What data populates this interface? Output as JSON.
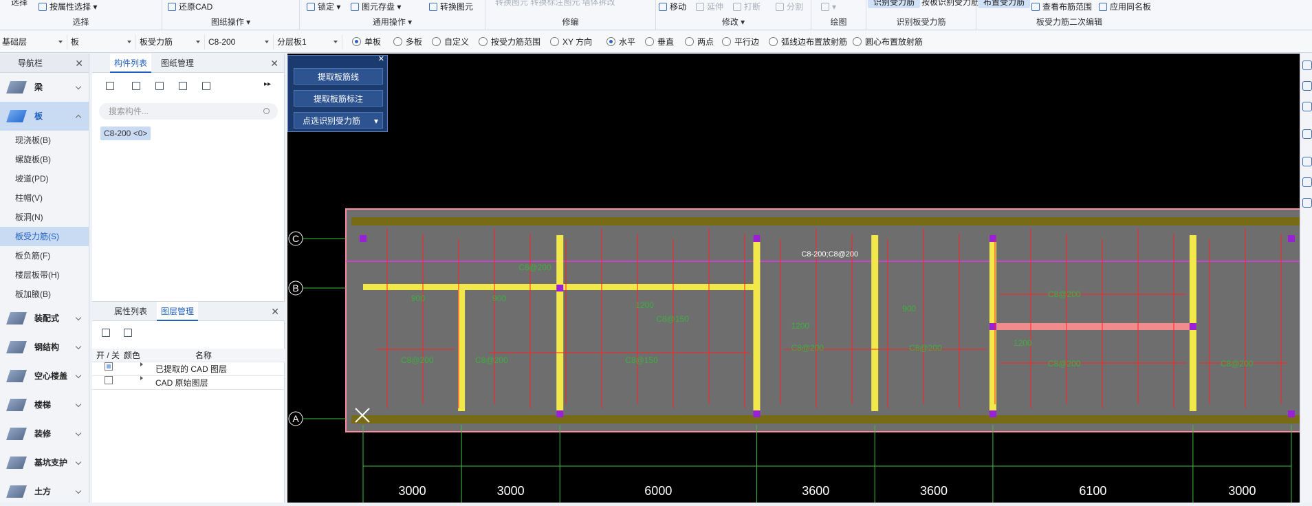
{
  "ribbon": {
    "select": {
      "filter_label": "按属性选择",
      "label": "选择",
      "partial": "选择"
    },
    "drawing": {
      "restore_label": "还原CAD",
      "label": "图纸操作"
    },
    "common": {
      "lock_label": "锁定",
      "store_label": "图元存盘",
      "convert_label": "转换图元",
      "label": "通用操作"
    },
    "modify_group": {
      "label": "修编",
      "faded": "转换图元 转换标注图元  墙体拆改"
    },
    "edit": {
      "move_label": "移动",
      "extend_label": "延伸",
      "break_label": "打断",
      "split_label": "分割",
      "label": "修改"
    },
    "draw": {
      "label": "绘图"
    },
    "identify": {
      "btn1": "识别受力筋",
      "btn2": "按板识别受力筋",
      "label": "识别板受力筋"
    },
    "second_edit": {
      "layout_label": "布置受力筋",
      "range_label": "查看布筋范围",
      "apply_label": "应用同名板",
      "label": "板受力筋二次编辑"
    }
  },
  "options": {
    "floor": "基础层",
    "type": "板",
    "subtype": "板受力筋",
    "spec": "C8-200",
    "layer": "分层板1",
    "radios": [
      {
        "label": "单板",
        "on": true
      },
      {
        "label": "多板",
        "on": false
      },
      {
        "label": "自定义",
        "on": false
      },
      {
        "label": "按受力筋范围",
        "on": false
      },
      {
        "label": "XY 方向",
        "on": false
      },
      {
        "label": "水平",
        "on": true
      },
      {
        "label": "垂直",
        "on": false
      },
      {
        "label": "两点",
        "on": false
      },
      {
        "label": "平行边",
        "on": false
      },
      {
        "label": "弧线边布置放射筋",
        "on": false
      },
      {
        "label": "圆心布置放射筋",
        "on": false
      }
    ]
  },
  "nav": {
    "title": "导航栏",
    "categories_top": [
      {
        "label": "梁",
        "icon": "beam-icon",
        "active": false
      },
      {
        "label": "板",
        "icon": "slab-icon",
        "active": true
      }
    ],
    "subitems": [
      {
        "label": "现浇板(B)",
        "active": false
      },
      {
        "label": "螺旋板(B)",
        "active": false
      },
      {
        "label": "坡道(PD)",
        "active": false
      },
      {
        "label": "柱帽(V)",
        "active": false
      },
      {
        "label": "板洞(N)",
        "active": false
      },
      {
        "label": "板受力筋(S)",
        "active": true
      },
      {
        "label": "板负筋(F)",
        "active": false
      },
      {
        "label": "楼层板带(H)",
        "active": false
      },
      {
        "label": "板加腋(B)",
        "active": false
      }
    ],
    "categories_bottom": [
      {
        "label": "装配式",
        "icon": "prefab-icon"
      },
      {
        "label": "钢结构",
        "icon": "steel-icon"
      },
      {
        "label": "空心楼盖",
        "icon": "hollow-floor-icon"
      },
      {
        "label": "楼梯",
        "icon": "stairs-icon"
      },
      {
        "label": "装修",
        "icon": "decoration-icon"
      },
      {
        "label": "基坑支护",
        "icon": "pit-support-icon"
      },
      {
        "label": "土方",
        "icon": "earthwork-icon"
      }
    ]
  },
  "components": {
    "tab_list": "构件列表",
    "tab_drawing": "图纸管理",
    "search_placeholder": "搜索构件...",
    "items": [
      "C8-200 <0>"
    ]
  },
  "layers": {
    "tab_props": "属性列表",
    "tab_layers": "图层管理",
    "col_toggle": "开 / 关",
    "col_color": "颜色",
    "col_name": "名称",
    "rows": [
      {
        "name": "已提取的 CAD 图层",
        "on": true
      },
      {
        "name": "CAD 原始图层",
        "on": false
      }
    ]
  },
  "float_panel": {
    "btn1": "提取板筋线",
    "btn2": "提取板筋标注",
    "btn3": "点选识别受力筋"
  },
  "cad": {
    "axes_rows": [
      "C",
      "B",
      "A"
    ],
    "spans": [
      {
        "label": "3000",
        "value": 3000
      },
      {
        "label": "3000",
        "value": 3000
      },
      {
        "label": "6000",
        "value": 6000
      },
      {
        "label": "3600",
        "value": 3600
      },
      {
        "label": "3600",
        "value": 3600
      },
      {
        "label": "6100",
        "value": 6100
      },
      {
        "label": "3000",
        "value": 3000
      }
    ],
    "header_note": "C8-200;C8@200",
    "rebar_labels": [
      "C8@200",
      "C8@200",
      "C8@200",
      "C8@150",
      "C8@200",
      "C8@200",
      "C8@200",
      "C8@200",
      "C8@200",
      "C8@150"
    ],
    "dims": [
      "900",
      "900",
      "1200",
      "1200",
      "900",
      "1200"
    ],
    "colors": {
      "frame": "#ff8aa0",
      "slab": "#6e6e6e",
      "beam": "#f3e84a",
      "rebar": "#ff2222",
      "text": "#3fae3f",
      "axis": "#3fbf3f",
      "mark": "#9a1fd8"
    }
  }
}
